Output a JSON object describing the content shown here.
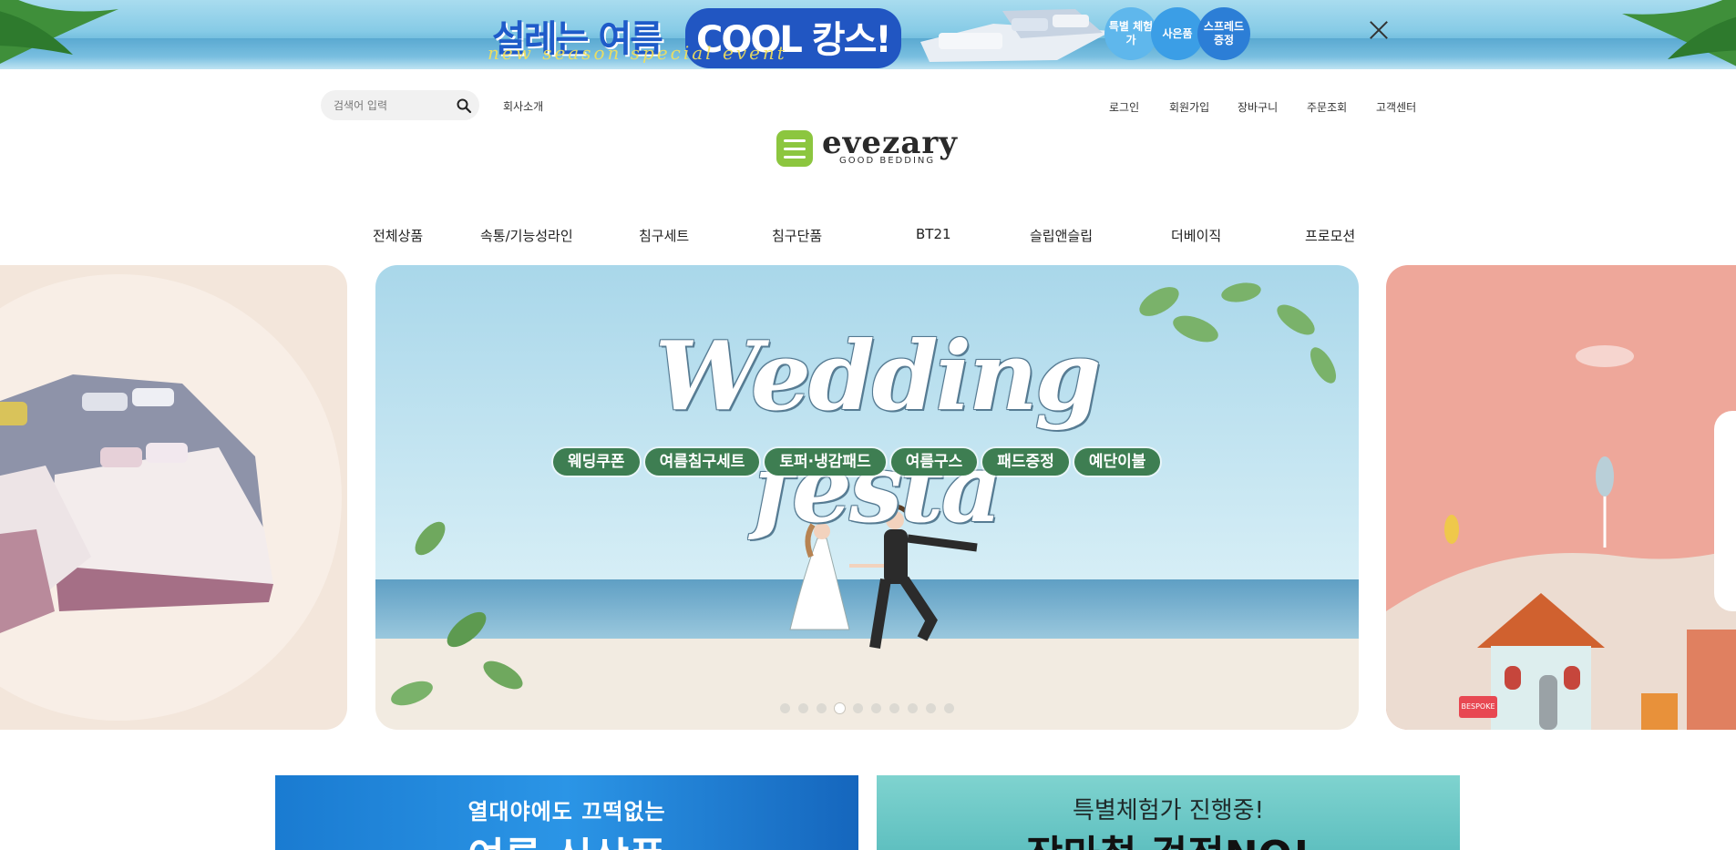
{
  "promo": {
    "headline": "설레는 여름",
    "highlight": "COOL 캉스!",
    "script": "new season special event",
    "badges": [
      "특별 체험가",
      "사은품",
      "스프레드 증정"
    ],
    "close_icon": "close-icon"
  },
  "header": {
    "search_placeholder": "검색어 입력",
    "search_icon": "search-icon",
    "company_link": "회사소개",
    "util_links": [
      "로그인",
      "회원가입",
      "장바구니",
      "주문조회",
      "고객센터"
    ],
    "logo_name": "evezary",
    "logo_tagline": "GOOD BEDDING"
  },
  "nav": {
    "items": [
      "전체상품",
      "속통/기능성라인",
      "침구세트",
      "침구단품",
      "BT21",
      "슬립앤슬립",
      "더베이직",
      "프로모션"
    ]
  },
  "slider": {
    "main_title": "Wedding festa",
    "tags": [
      "웨딩쿠폰",
      "여름침구세트",
      "토퍼·냉감패드",
      "여름구스",
      "패드증정",
      "예단이불"
    ],
    "right_badge": "BESPOKE",
    "dot_count": 10,
    "active_dot": 4
  },
  "banners": {
    "left_line1": "열대야에도 끄떡없는",
    "left_line2": "여름 신상품",
    "right_line1": "특별체험가 진행중!",
    "right_line2": "장마철 걱정NO!"
  },
  "colors": {
    "accent_green": "#3e7e52",
    "logo_green": "#8cc63f",
    "promo_blue": "#2156c2"
  }
}
